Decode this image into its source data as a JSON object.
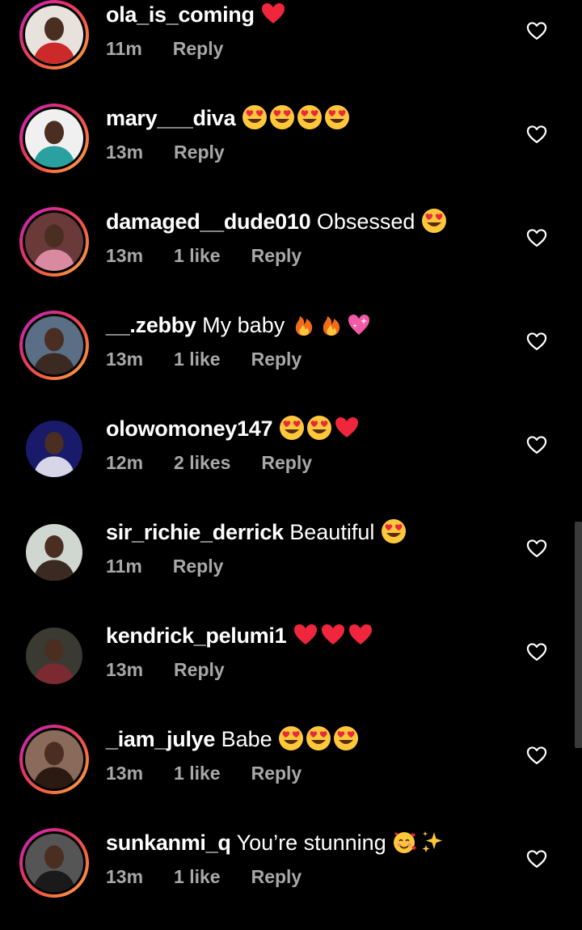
{
  "comments": [
    {
      "username": "ola_is_coming",
      "text": "",
      "emojis": [
        "red-heart"
      ],
      "time": "11m",
      "likes": "",
      "reply": "Reply",
      "story_ring": true,
      "avatar_bg": "#e8e2dc",
      "avatar_fg": "#cc2a2a"
    },
    {
      "username": "mary___diva",
      "text": "",
      "emojis": [
        "heart-eyes",
        "heart-eyes",
        "heart-eyes",
        "heart-eyes"
      ],
      "time": "13m",
      "likes": "",
      "reply": "Reply",
      "story_ring": true,
      "avatar_bg": "#f0f0f0",
      "avatar_fg": "#2aa0a0"
    },
    {
      "username": "damaged__dude010",
      "text": "Obsessed",
      "emojis": [
        "heart-eyes"
      ],
      "time": "13m",
      "likes": "1 like",
      "reply": "Reply",
      "story_ring": true,
      "avatar_bg": "#6a3a3a",
      "avatar_fg": "#d98aa0"
    },
    {
      "username": "__.zebby",
      "text": "My baby",
      "emojis": [
        "fire",
        "fire",
        "sparkling-heart"
      ],
      "time": "13m",
      "likes": "1 like",
      "reply": "Reply",
      "story_ring": true,
      "avatar_bg": "#5a6e85",
      "avatar_fg": "#3a2a22"
    },
    {
      "username": "olowomoney147",
      "text": "",
      "emojis": [
        "heart-eyes",
        "heart-eyes",
        "red-heart"
      ],
      "time": "12m",
      "likes": "2 likes",
      "reply": "Reply",
      "story_ring": false,
      "avatar_bg": "#1a1a6a",
      "avatar_fg": "#d6d6e8"
    },
    {
      "username": "sir_richie_derrick",
      "text": "Beautiful",
      "emojis": [
        "heart-eyes"
      ],
      "time": "11m",
      "likes": "",
      "reply": "Reply",
      "story_ring": false,
      "avatar_bg": "#cfd7d0",
      "avatar_fg": "#3a2a22"
    },
    {
      "username": "kendrick_pelumi1",
      "text": "",
      "emojis": [
        "red-heart",
        "red-heart",
        "red-heart"
      ],
      "time": "13m",
      "likes": "",
      "reply": "Reply",
      "story_ring": false,
      "avatar_bg": "#3a3a33",
      "avatar_fg": "#7a2a30"
    },
    {
      "username": "_iam_julye",
      "text": "Babe",
      "emojis": [
        "heart-eyes",
        "heart-eyes",
        "heart-eyes"
      ],
      "time": "13m",
      "likes": "1 like",
      "reply": "Reply",
      "story_ring": true,
      "avatar_bg": "#8a6a5a",
      "avatar_fg": "#2a1a12"
    },
    {
      "username": "sunkanmi_q",
      "text": "You’re stunning",
      "emojis": [
        "smiling-face-with-hearts",
        "sparkles"
      ],
      "time": "13m",
      "likes": "1 like",
      "reply": "Reply",
      "story_ring": true,
      "avatar_bg": "#555555",
      "avatar_fg": "#1a1a1a"
    }
  ],
  "colors": {
    "background": "#000000",
    "text_primary": "#ffffff",
    "text_secondary": "#a8a8a8",
    "scrollbar": "#3a3a3a"
  },
  "icons": {
    "like": "heart-outline-icon"
  }
}
